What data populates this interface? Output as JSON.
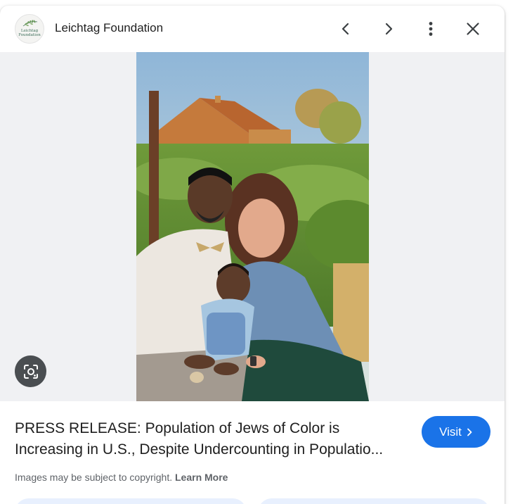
{
  "header": {
    "site_name": "Leichtag Foundation",
    "logo_text_1": "Leichtag",
    "logo_text_2": "Foundation",
    "prev_icon": "chevron-left-icon",
    "next_icon": "chevron-right-icon",
    "more_icon": "more-vert-icon",
    "close_icon": "close-icon"
  },
  "image": {
    "lens_icon": "google-lens-icon"
  },
  "result": {
    "title_line_1": "PRESS RELEASE: Population of Jews of Color is",
    "title_line_2": "Increasing in U.S., Despite Undercounting in Populatio...",
    "visit_label": "Visit",
    "copyright_text": "Images may be subject to copyright.",
    "learn_more_label": "Learn More"
  },
  "colors": {
    "accent": "#1a73e8",
    "pill_bg": "#e8f0fe",
    "image_bg": "#f0f1f3"
  }
}
